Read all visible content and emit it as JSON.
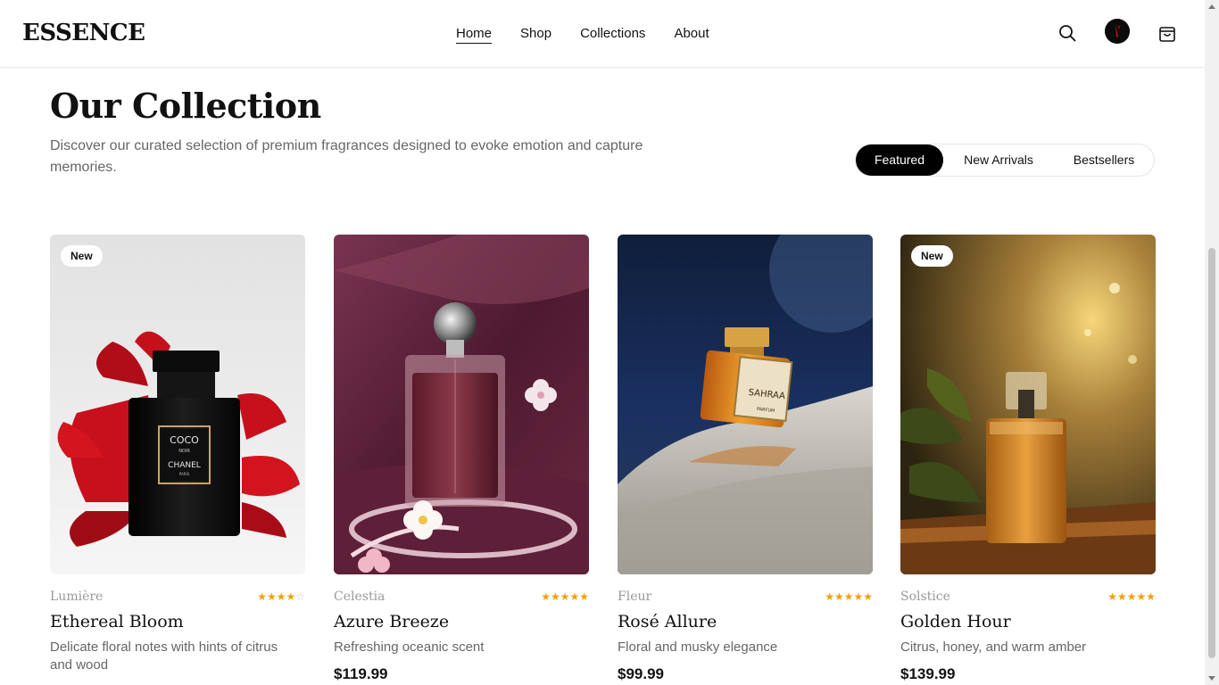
{
  "header": {
    "logo": "ESSENCE",
    "nav": [
      "Home",
      "Shop",
      "Collections",
      "About"
    ],
    "active_nav": "Home",
    "icons": [
      "search-icon",
      "avatar",
      "bag-icon"
    ]
  },
  "section": {
    "title": "Our Collection",
    "description": "Discover our curated selection of premium fragrances designed to evoke emotion and capture memories.",
    "tabs": [
      "Featured",
      "New Arrivals",
      "Bestsellers"
    ],
    "active_tab": "Featured"
  },
  "products": [
    {
      "badge": "New",
      "brand": "Lumière",
      "name": "Ethereal Bloom",
      "description": "Delicate floral notes with hints of citrus and wood",
      "price": "",
      "rating": 4,
      "bottle_label_1": "COCO",
      "bottle_label_2": "NOIR",
      "bottle_label_3": "CHANEL",
      "bottle_label_4": "PARIS"
    },
    {
      "badge": "",
      "brand": "Celestia",
      "name": "Azure Breeze",
      "description": "Refreshing oceanic scent",
      "price": "$119.99",
      "rating": 5
    },
    {
      "badge": "",
      "brand": "Fleur",
      "name": "Rosé Allure",
      "description": "Floral and musky elegance",
      "price": "$99.99",
      "rating": 5,
      "bottle_label_1": "SAHRAA",
      "bottle_label_2": "PARFUM"
    },
    {
      "badge": "New",
      "brand": "Solstice",
      "name": "Golden Hour",
      "description": "Citrus, honey, and warm amber",
      "price": "$139.99",
      "rating": 5
    }
  ],
  "colors": {
    "accent": "#000000",
    "star": "#f59e0b",
    "muted_text": "#666666"
  }
}
